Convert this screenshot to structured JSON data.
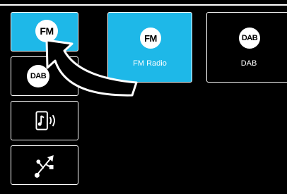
{
  "sidebar": {
    "items": [
      {
        "badge": "FM",
        "icon": "fm-icon",
        "active": true
      },
      {
        "badge": "DAB",
        "icon": "dab-icon",
        "active": false
      },
      {
        "icon": "bluetooth-audio-icon",
        "active": false
      },
      {
        "icon": "usb-icon",
        "active": false
      }
    ]
  },
  "main": {
    "tiles": [
      {
        "badge": "FM",
        "label": "FM Radio",
        "active": true
      },
      {
        "badge": "DAB",
        "label": "DAB",
        "active": false
      }
    ]
  },
  "colors": {
    "accent": "#1eb8e8",
    "background": "#000000",
    "arrow": "#ffffff"
  },
  "annotation": {
    "icon": "curved-arrow-icon",
    "direction": "from FM Radio tile toward FM sidebar item"
  }
}
